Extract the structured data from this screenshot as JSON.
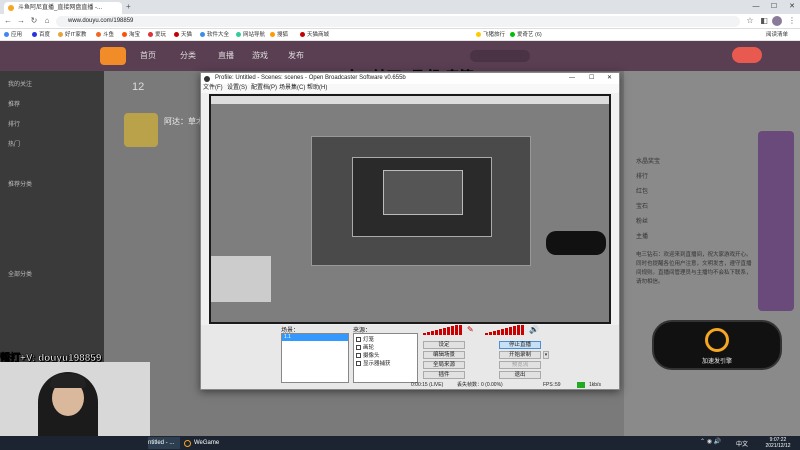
{
  "browser": {
    "tabs": [
      {
        "title": "斗鱼阿尼直播_直接网盘直播 -...",
        "active": true
      },
      {
        "title": "",
        "active": false
      }
    ],
    "url": "www.douyu.com/198859",
    "new_tab": "+",
    "win_min": "—",
    "win_max": "☐",
    "win_close": "✕",
    "bookmarks": [
      "应用",
      "百度",
      "好IT家教",
      "斗鱼",
      "淘宝",
      "爱玩",
      "天猫",
      "软件大全",
      "网站导航",
      "搜狐",
      "天猫商城",
      "飞猪旅行",
      "爱奇艺 (6)"
    ],
    "reading_list": "阅读清单"
  },
  "site": {
    "nav": [
      "首页",
      "分类",
      "直播",
      "游戏",
      "发布"
    ],
    "title_overlay": "电三钻石2 飞机-房管",
    "streamer_count": "12",
    "streamer_name": "阿达：草木",
    "sidebar_sections": [
      "我的关注",
      "推荐",
      "排行",
      "热门",
      "推荐分类",
      "全部分类"
    ],
    "right_panel_rows": [
      "水晶奖宝",
      "排行",
      "红包",
      "宝石",
      "粉丝",
      "主播"
    ],
    "chat_preview": "电三钻石：欢迎来到直播间，祝大家游戏开心。同时也提醒各位用户注意，文明发言，遵守直播间规则。直播间管理员与主播均不会私下联系，请勿相信。"
  },
  "obs": {
    "title": "Profile: Untitled - Scenes: scenes - Open Broadcaster Software v0.655b",
    "menus": [
      "文件(F)",
      "设置(S)",
      "配置档(P)",
      "场景集(C)",
      "帮助(H)"
    ],
    "scenes_label": "场景：",
    "sources_label": "来源：",
    "scene_items": [
      "1.1"
    ],
    "sources": [
      "灯笼",
      "画轮",
      "摄像头",
      "显示器捕获"
    ],
    "buttons": {
      "settings": "设定",
      "stop_stream": "停止直播",
      "edit_scene": "编辑场景",
      "start_record": "开始录制",
      "global_sources": "全局来源",
      "preview": "预览流",
      "plugins": "插件",
      "exit": "退出"
    },
    "status": {
      "time": "0:00:15 (LIVE)",
      "dropped_label": "丢失帧数：",
      "dropped": "0 (0.00%)",
      "fps_label": "FPS：",
      "fps": "59",
      "bitrate": "1kb/s"
    }
  },
  "cam": {
    "label": "帮打+V: douyu198859"
  },
  "boost": {
    "label": "加速发引擎"
  },
  "taskbar": {
    "items": [
      "ntitled - ...",
      "WeGame"
    ],
    "time": "9:07:22",
    "date": "2021/12/12",
    "lang": "中文"
  }
}
